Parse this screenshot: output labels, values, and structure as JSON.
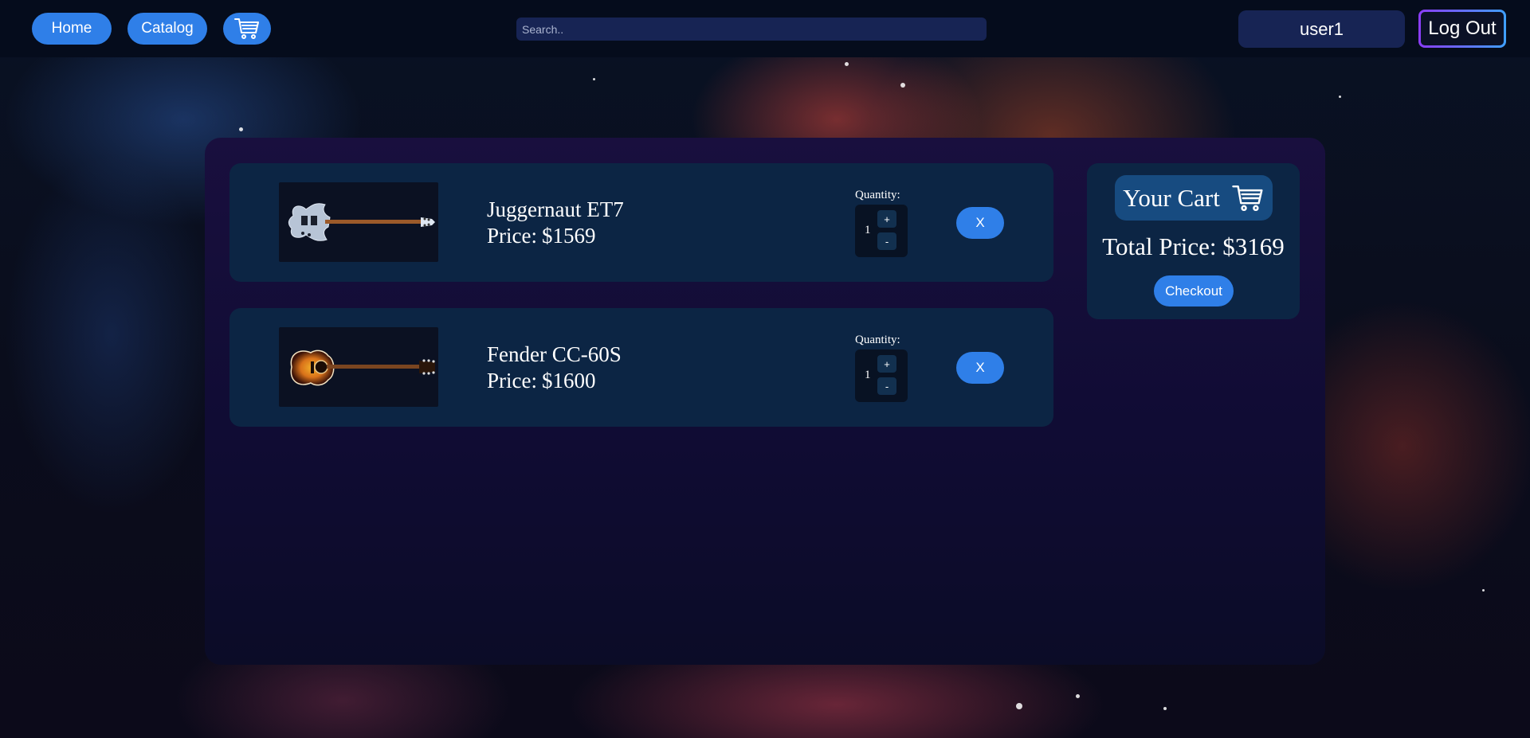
{
  "nav": {
    "home_label": "Home",
    "catalog_label": "Catalog",
    "cart_icon": "cart-icon"
  },
  "search": {
    "placeholder": "Search..",
    "value": ""
  },
  "user": {
    "name": "user1",
    "logout_label": "Log Out"
  },
  "cart_items": [
    {
      "image": "electric-guitar-image",
      "name": "Juggernaut ET7",
      "price_label": "Price:",
      "price": "$1569",
      "quantity_label": "Quantity:",
      "quantity": "1",
      "increment_label": "+",
      "decrement_label": "-",
      "remove_label": "X"
    },
    {
      "image": "acoustic-guitar-image",
      "name": "Fender CC-60S",
      "price_label": "Price:",
      "price": "$1600",
      "quantity_label": "Quantity:",
      "quantity": "1",
      "increment_label": "+",
      "decrement_label": "-",
      "remove_label": "X"
    }
  ],
  "summary": {
    "title": "Your Cart",
    "title_icon": "cart-icon",
    "total_label": "Total Price:",
    "total": "$3169",
    "checkout_label": "Checkout"
  },
  "colors": {
    "accent": "#2f7fe8",
    "card": "#0c2544",
    "panel": "#130e38",
    "topbar": "#050c1c",
    "logout_gradient_start": "#8b3cf7",
    "logout_gradient_end": "#3fa0ff"
  }
}
